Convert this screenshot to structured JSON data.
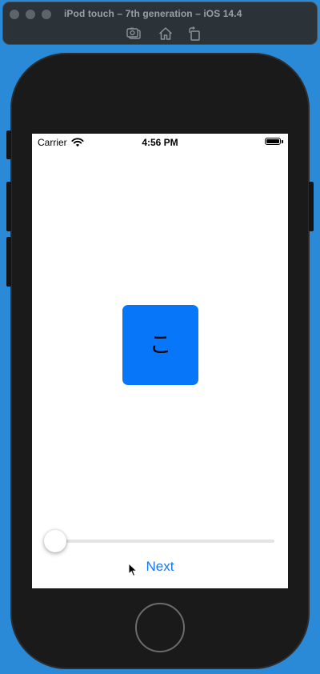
{
  "window": {
    "title": "iPod touch – 7th generation – iOS 14.4",
    "toolbar_icons": [
      "screenshot-icon",
      "home-icon",
      "rotate-icon"
    ]
  },
  "statusbar": {
    "carrier": "Carrier",
    "time": "4:56 PM",
    "wifi_icon": "wifi-icon",
    "battery_icon": "battery-icon"
  },
  "card": {
    "character": "こ",
    "color": "#0876f8"
  },
  "slider": {
    "value": 0
  },
  "next_button": {
    "label": "Next",
    "color": "#1676f3"
  }
}
